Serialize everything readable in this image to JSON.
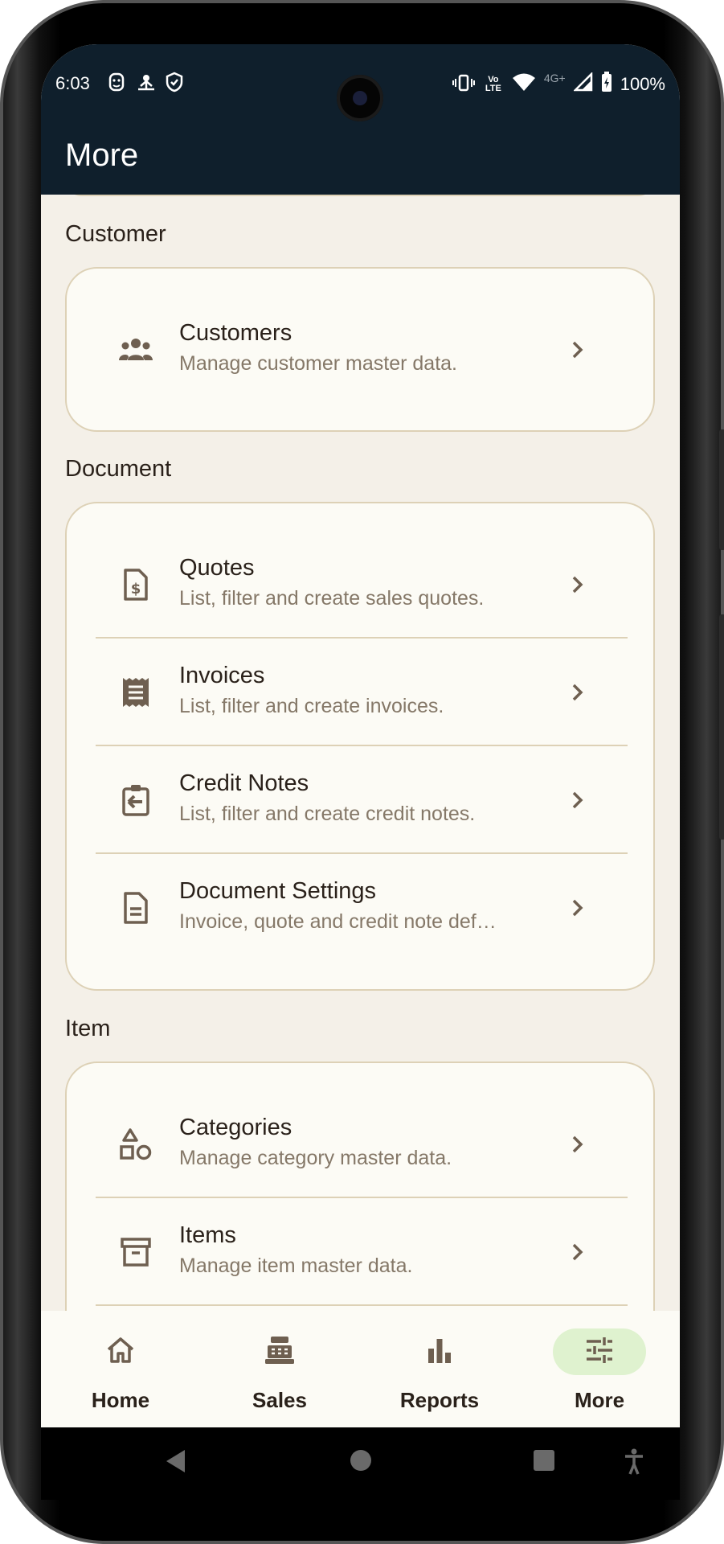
{
  "status_bar": {
    "time": "6:03",
    "left_icons": [
      "face-icon",
      "hotspot-icon",
      "shield-icon"
    ],
    "right_icons": [
      "vibrate-icon",
      "volte-icon",
      "wifi-icon",
      "4g-icon",
      "signal-icon",
      "battery-icon"
    ],
    "network_label": "4G+",
    "volte_label": "Vo LTE",
    "battery": "100%"
  },
  "app_bar": {
    "title": "More"
  },
  "sections": [
    {
      "title": "Customer",
      "items": [
        {
          "icon": "people-icon",
          "title": "Customers",
          "subtitle": "Manage customer master data."
        }
      ]
    },
    {
      "title": "Document",
      "items": [
        {
          "icon": "quote-document-icon",
          "title": "Quotes",
          "subtitle": "List, filter and create sales quotes."
        },
        {
          "icon": "receipt-icon",
          "title": "Invoices",
          "subtitle": "List, filter and create invoices."
        },
        {
          "icon": "credit-note-icon",
          "title": "Credit Notes",
          "subtitle": "List, filter and create credit notes."
        },
        {
          "icon": "document-settings-icon",
          "title": "Document Settings",
          "subtitle": "Invoice, quote and credit note def…"
        }
      ]
    },
    {
      "title": "Item",
      "items": [
        {
          "icon": "category-shapes-icon",
          "title": "Categories",
          "subtitle": "Manage category master data."
        },
        {
          "icon": "archive-box-icon",
          "title": "Items",
          "subtitle": "Manage item master data."
        }
      ]
    }
  ],
  "bottom_nav": {
    "items": [
      {
        "label": "Home",
        "icon": "home-icon",
        "active": false
      },
      {
        "label": "Sales",
        "icon": "cash-register-icon",
        "active": false
      },
      {
        "label": "Reports",
        "icon": "bar-chart-icon",
        "active": false
      },
      {
        "label": "More",
        "icon": "sliders-icon",
        "active": true
      }
    ]
  },
  "colors": {
    "app_bar": "#0f1f2c",
    "background": "#f4f0e8",
    "card": "#fcfbf5",
    "card_border": "#ddd1b6",
    "text_primary": "#2a211a",
    "text_secondary": "#857868",
    "icon": "#6e5f50",
    "active_pill": "#dff2cf"
  }
}
